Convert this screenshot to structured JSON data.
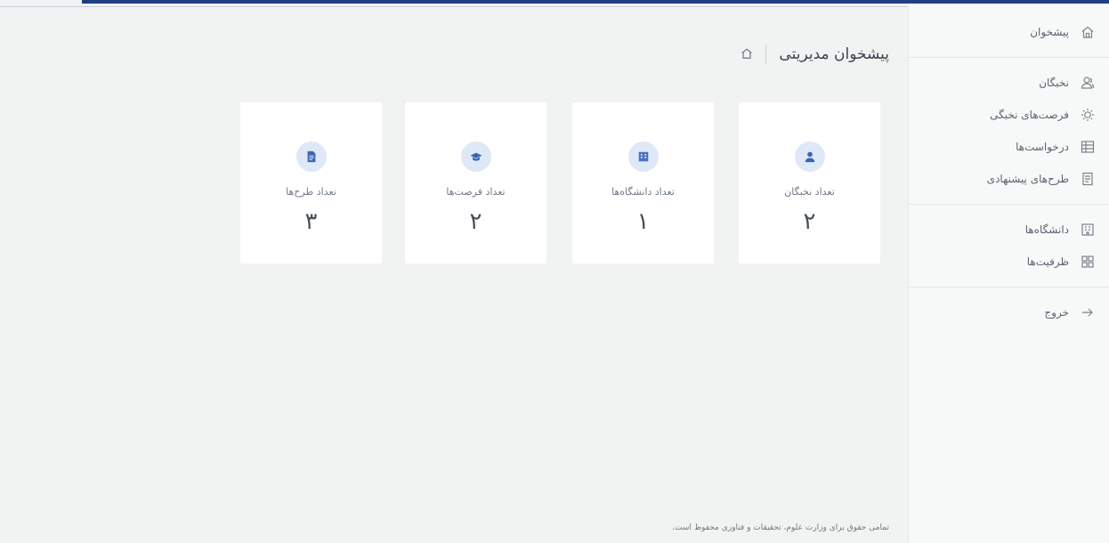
{
  "header": {
    "title": "پیشخوان مدیریتی"
  },
  "sidebar": {
    "items": [
      {
        "label": "پیشخوان",
        "icon": "home-icon"
      },
      {
        "label": "نخبگان",
        "icon": "users-icon"
      },
      {
        "label": "فرصت‌های نخبگی",
        "icon": "lightbulb-icon"
      },
      {
        "label": "درخواست‌ها",
        "icon": "list-icon"
      },
      {
        "label": "طرح‌های پیشنهادی",
        "icon": "document-icon"
      },
      {
        "label": "دانشگاه‌ها",
        "icon": "building-icon"
      },
      {
        "label": "ظرفیت‌ها",
        "icon": "grid-icon"
      },
      {
        "label": "خروج",
        "icon": "arrow-right-icon"
      }
    ]
  },
  "cards": [
    {
      "label": "تعداد نخبگان",
      "value": "۲",
      "icon": "user-icon"
    },
    {
      "label": "تعداد دانشگاه‌ها",
      "value": "۱",
      "icon": "building-icon"
    },
    {
      "label": "تعداد فرصت‌ها",
      "value": "۲",
      "icon": "graduation-cap-icon"
    },
    {
      "label": "تعداد طرح‌ها",
      "value": "۳",
      "icon": "file-icon"
    }
  ],
  "footer": {
    "text": "تمامی حقوق برای وزارت علوم، تحقیقات و فناوری محفوظ است."
  },
  "colors": {
    "accent": "#1f3f82",
    "badge_bg": "#dfe8f7",
    "badge_icon": "#3b64b2",
    "background": "#f1f3f2"
  }
}
